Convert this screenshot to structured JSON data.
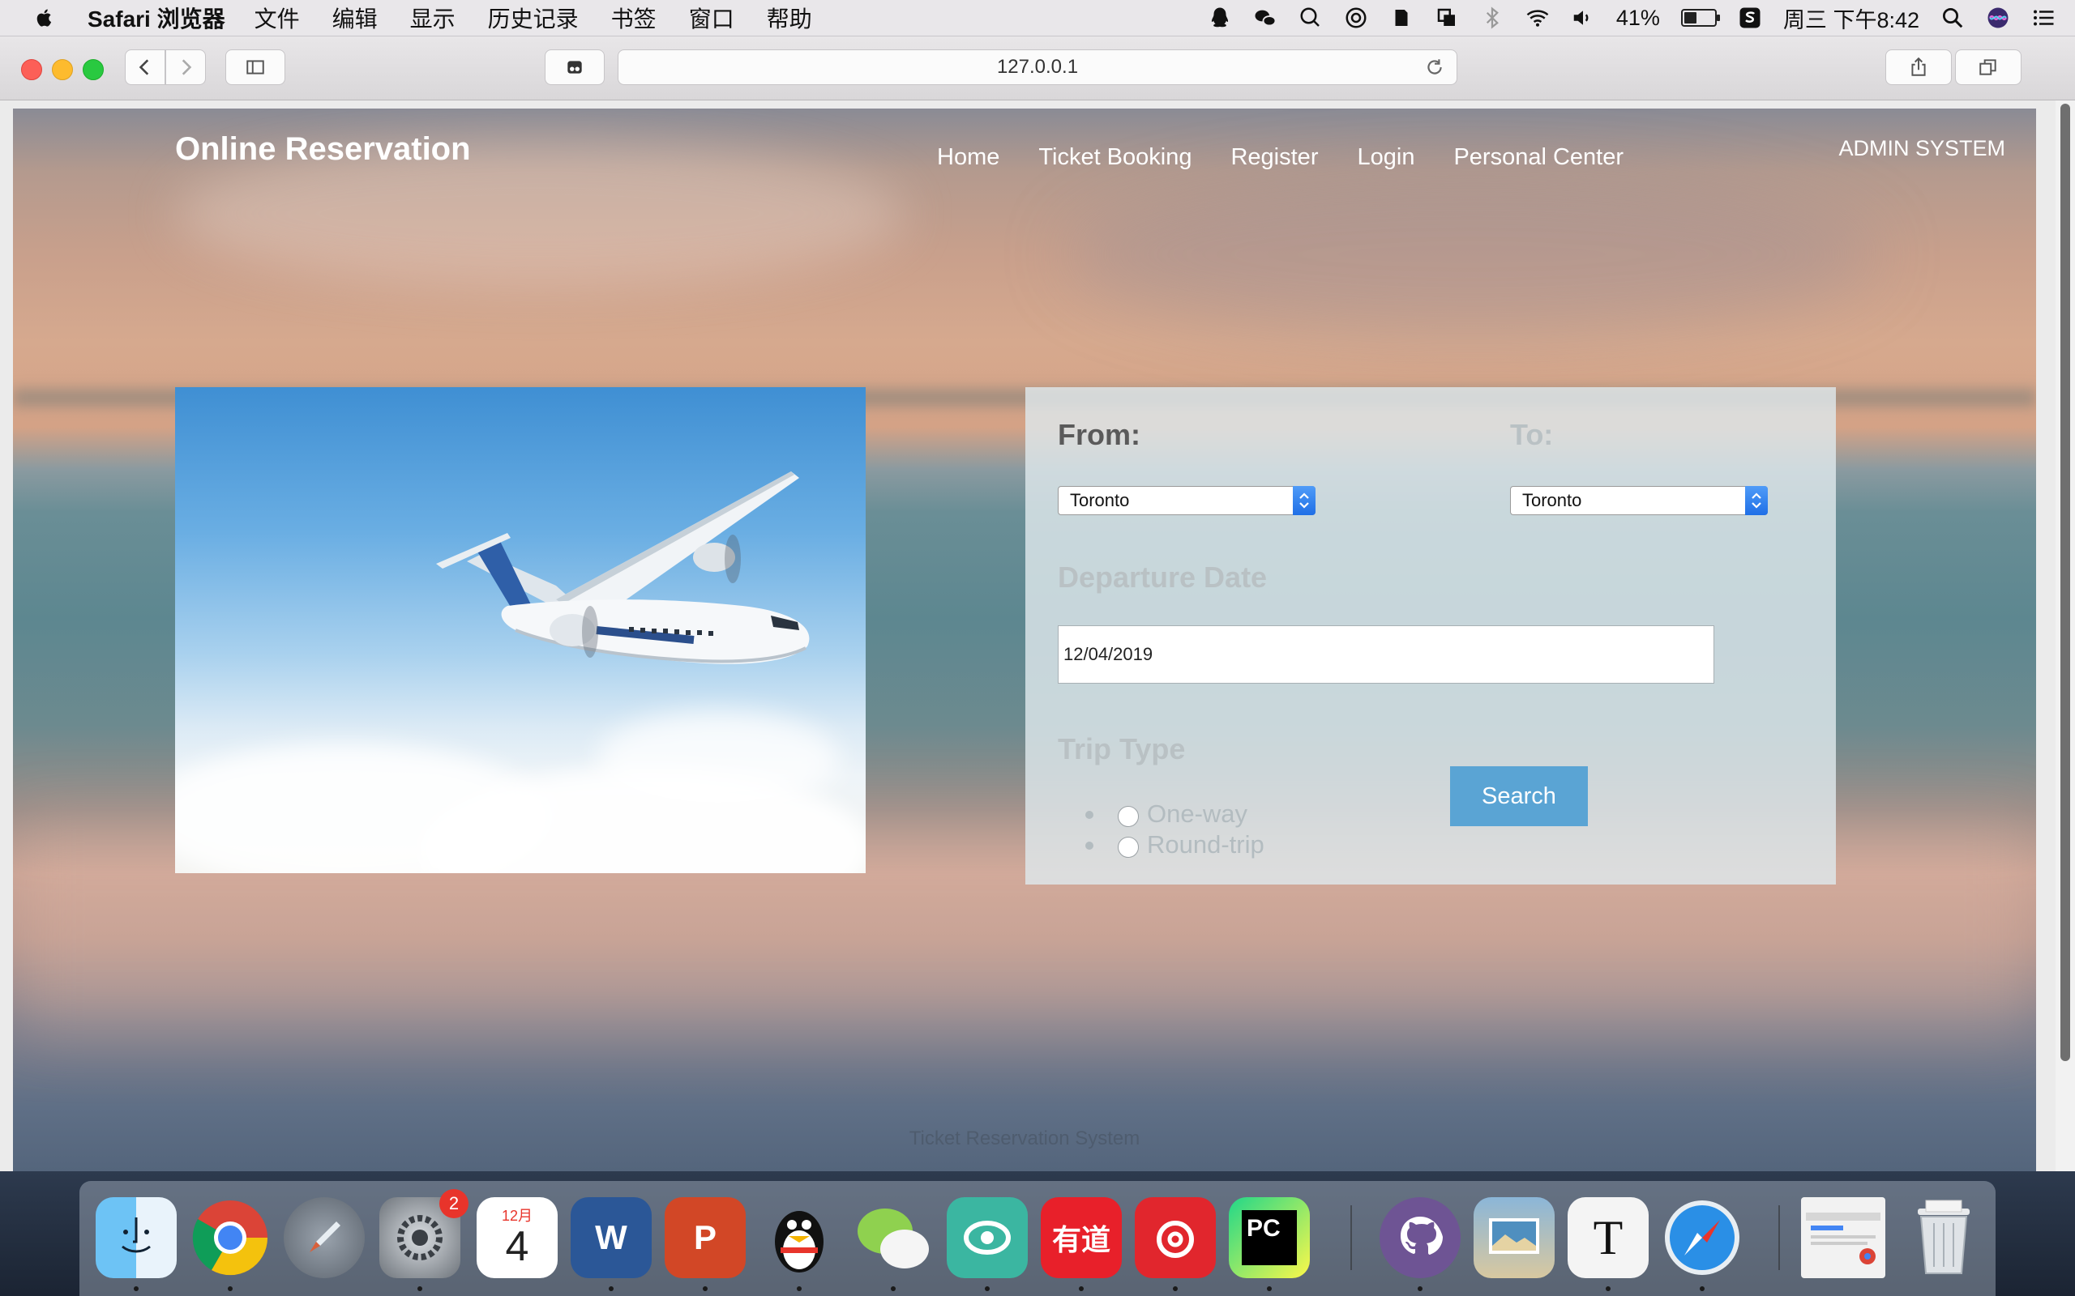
{
  "menubar": {
    "app_name": "Safari 浏览器",
    "menus": [
      "文件",
      "编辑",
      "显示",
      "历史记录",
      "书签",
      "窗口",
      "帮助"
    ],
    "battery": "41%",
    "battery_level": 0.41,
    "clock": "周三 下午8:42"
  },
  "browser": {
    "url": "127.0.0.1",
    "new_tab": "+"
  },
  "site": {
    "logo": "Online Reservation",
    "nav": [
      "Home",
      "Ticket Booking",
      "Register",
      "Login",
      "Personal Center"
    ],
    "admin": "ADMIN SYSTEM"
  },
  "booking": {
    "from_label": "From:",
    "to_label": "To:",
    "from_value": "Toronto",
    "to_value": "Toronto",
    "date_label": "Departure Date",
    "date_value": "12/04/2019",
    "trip_label": "Trip Type",
    "trip_options": [
      "One-way",
      "Round-trip"
    ],
    "search": "Search"
  },
  "footer": "Ticket Reservation System",
  "dock": {
    "calendar_month": "12月",
    "calendar_day": "4",
    "prefs_badge": "2",
    "word_letter": "W",
    "ppt_letter": "P",
    "youdao": "有道",
    "pycharm": "PC",
    "typora": "T"
  }
}
